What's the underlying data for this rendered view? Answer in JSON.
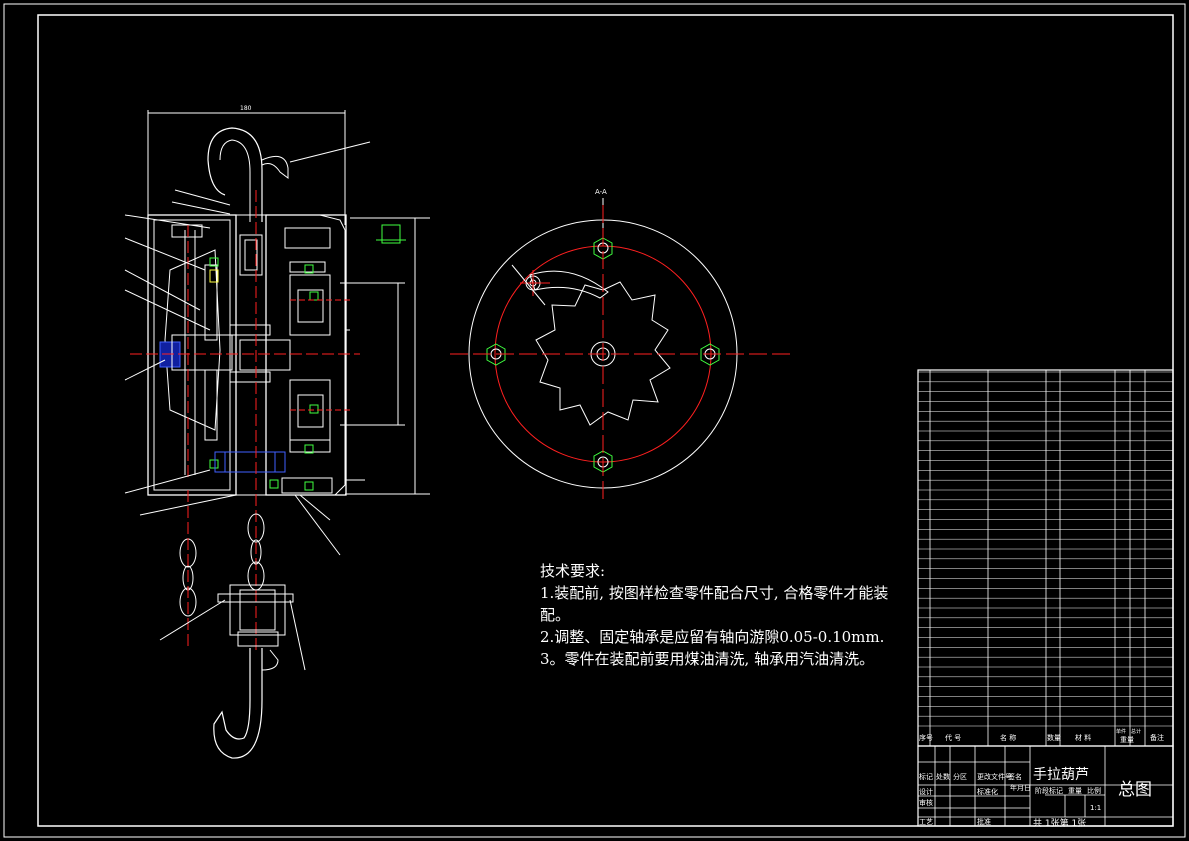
{
  "drawing": {
    "title": "手拉葫芦",
    "drawing_type": "总图",
    "sheet_info": "共 1张第 1张",
    "section_label": "A-A",
    "dimension_total_width": "180",
    "colors": {
      "background": "#000000",
      "line_white": "#ffffff",
      "centerline_red": "#ff2020",
      "part_yellow": "#ffff40",
      "part_green": "#40ff40",
      "part_blue": "#4060ff",
      "part_cyan": "#40ffff"
    }
  },
  "tech_requirements": {
    "heading": "技术要求:",
    "items": [
      "1.装配前, 按图样检查零件配合尺寸, 合格零件才能装配。",
      "2.调整、固定轴承是应留有轴向游隙0.05-0.10mm.",
      "3。零件在装配前要用煤油清洗, 轴承用汽油清洗。"
    ]
  },
  "bom_header": {
    "seq": "序号",
    "code": "代 号",
    "name": "名 称",
    "qty": "数量",
    "material": "材 料",
    "weight_single": "单件",
    "weight_total": "总计",
    "weight": "重量",
    "remark": "备注"
  },
  "title_block": {
    "row1": [
      "标记",
      "处数",
      "分区",
      "更改文件号",
      "签名",
      "年月日"
    ],
    "row2": [
      "设计",
      "",
      "",
      "标准化",
      "",
      ""
    ],
    "row3": [
      "审核"
    ],
    "row4": [
      "工艺",
      "",
      "",
      "批准"
    ],
    "stage_label": "阶段标记",
    "weight_label": "重量",
    "scale_label": "比例",
    "scale_value": "1:1"
  }
}
